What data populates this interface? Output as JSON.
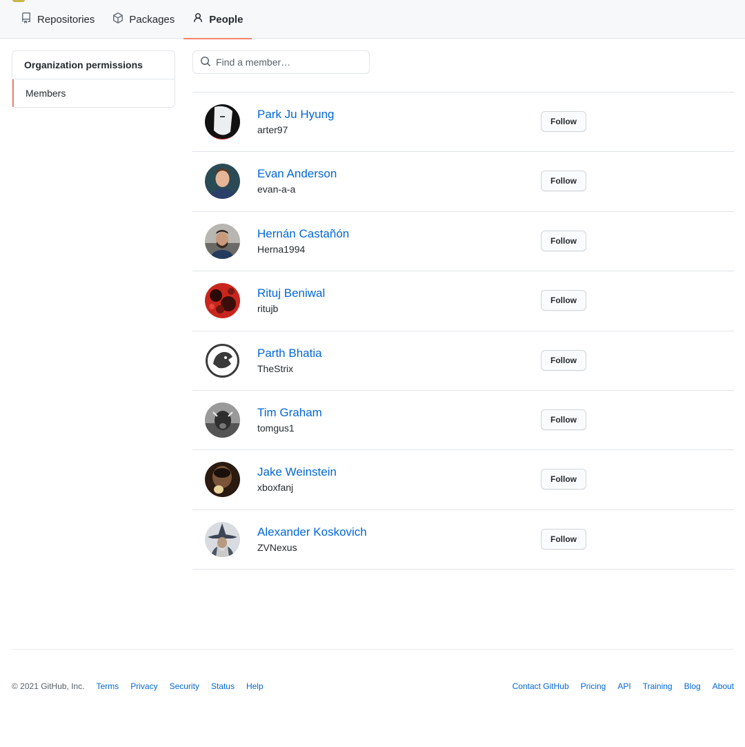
{
  "nav": {
    "tabs": [
      {
        "label": "Repositories",
        "icon": "repo-icon"
      },
      {
        "label": "Packages",
        "icon": "package-icon"
      },
      {
        "label": "People",
        "icon": "person-icon",
        "active": true
      }
    ],
    "active_color": "#f9826c"
  },
  "sidebar": {
    "heading": "Organization permissions",
    "items": [
      {
        "label": "Members",
        "selected": true
      }
    ]
  },
  "search": {
    "placeholder": "Find a member…",
    "value": ""
  },
  "members": [
    {
      "name": "Park Ju Hyung",
      "login": "arter97",
      "follow_label": "Follow"
    },
    {
      "name": "Evan Anderson",
      "login": "evan-a-a",
      "follow_label": "Follow"
    },
    {
      "name": "Hernán Castañón",
      "login": "Herna1994",
      "follow_label": "Follow"
    },
    {
      "name": "Rituj Beniwal",
      "login": "ritujb",
      "follow_label": "Follow"
    },
    {
      "name": "Parth Bhatia",
      "login": "TheStrix",
      "follow_label": "Follow"
    },
    {
      "name": "Tim Graham",
      "login": "tomgus1",
      "follow_label": "Follow"
    },
    {
      "name": "Jake Weinstein",
      "login": "xboxfanj",
      "follow_label": "Follow"
    },
    {
      "name": "Alexander Koskovich",
      "login": "ZVNexus",
      "follow_label": "Follow"
    }
  ],
  "footer": {
    "copyright": "© 2021 GitHub, Inc.",
    "left_links": [
      "Terms",
      "Privacy",
      "Security",
      "Status",
      "Help"
    ],
    "right_links": [
      "Contact GitHub",
      "Pricing",
      "API",
      "Training",
      "Blog",
      "About"
    ]
  },
  "colors": {
    "link": "#0366d6",
    "border": "#e1e4e8",
    "nav_bg": "#f6f8fa"
  }
}
